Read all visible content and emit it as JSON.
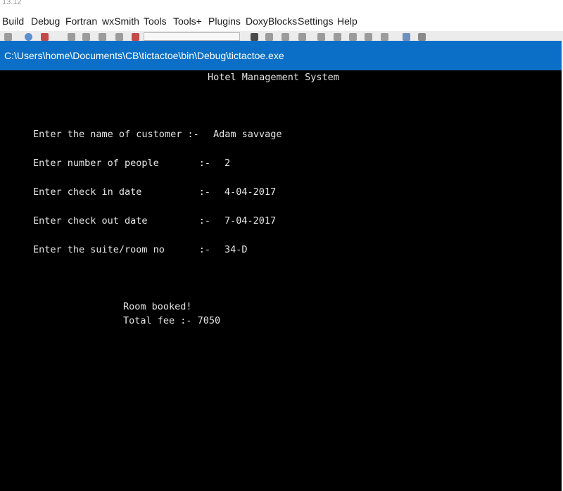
{
  "ide": {
    "top_text": "13.12",
    "menu": [
      "Build",
      "Debug",
      "Fortran",
      "wxSmith",
      "Tools",
      "Tools+",
      "Plugins",
      "DoxyBlocks",
      "Settings",
      "Help"
    ]
  },
  "console_window": {
    "title": "C:\\Users\\home\\Documents\\CB\\tictactoe\\bin\\Debug\\tictactoe.exe",
    "heading": "Hotel Management System",
    "prompts": [
      {
        "label": "Enter the name of customer :-",
        "value": "Adam savvage"
      },
      {
        "label": "Enter number of people       :-",
        "value": "2"
      },
      {
        "label": "Enter check in date          :-",
        "value": "4-04-2017"
      },
      {
        "label": "Enter check out date         :-",
        "value": "7-04-2017"
      },
      {
        "label": "Enter the suite/room no      :-",
        "value": "34-D"
      }
    ],
    "result_line1": "Room booked!",
    "result_line2": "Total fee :- 7050"
  },
  "colors": {
    "titlebar": "#0b6fc7",
    "console_bg": "#000000",
    "console_text": "#e6e6e6"
  }
}
